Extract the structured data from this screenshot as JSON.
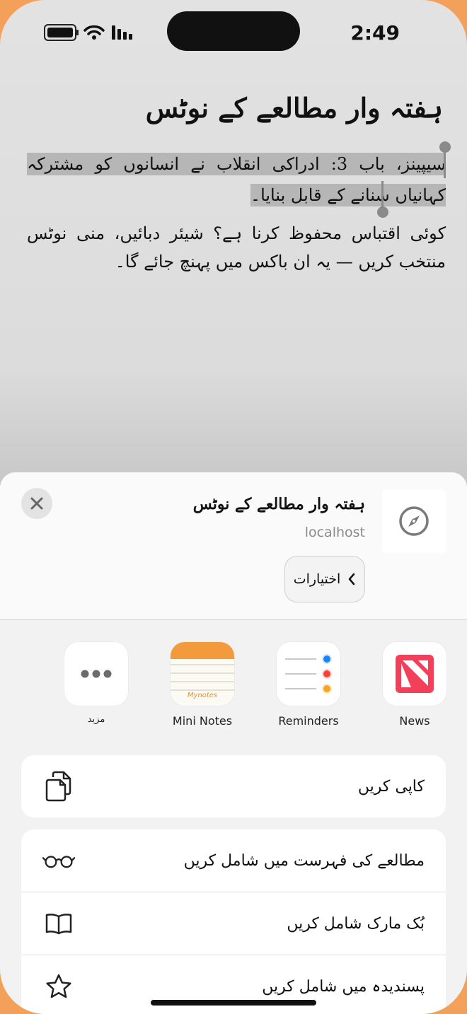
{
  "status": {
    "time": "2:49"
  },
  "document": {
    "title": "ہفتہ وار مطالعے کے نوٹس",
    "paragraph1": "سیپینز، باب 3: ادراکی انقلاب نے انسانوں کو مشترکہ کہانیاں سنانے کے قابل بنایا۔",
    "paragraph2": "کوئی اقتباس محفوظ کرنا ہے؟ شیئر دبائیں، منی نوٹس منتخب کریں — یہ ان باکس میں پہنچ جائے گا۔"
  },
  "share_sheet": {
    "title": "ہفتہ وار مطالعے کے نوٹس",
    "host": "localhost",
    "options_label": "اختیارات",
    "apps": [
      {
        "label": "News",
        "icon": "news-icon"
      },
      {
        "label": "Reminders",
        "icon": "reminders-icon"
      },
      {
        "label": "Mini Notes",
        "icon": "notes-icon",
        "icon_text": "Mynotes"
      },
      {
        "label": "مزید",
        "icon": "more-icon"
      }
    ],
    "actions_primary": [
      {
        "label": "کاپی کریں",
        "icon": "copy-icon"
      }
    ],
    "actions_secondary": [
      {
        "label": "مطالعے کی فہرست میں شامل کریں",
        "icon": "glasses-icon"
      },
      {
        "label": "بُک مارک شامل کریں",
        "icon": "book-icon"
      },
      {
        "label": "پسندیدہ میں شامل کریں",
        "icon": "star-icon"
      }
    ]
  },
  "colors": {
    "accent_orange": "#f39a3c",
    "news_red": "#f2405a",
    "frame": "#1b1b1d"
  }
}
